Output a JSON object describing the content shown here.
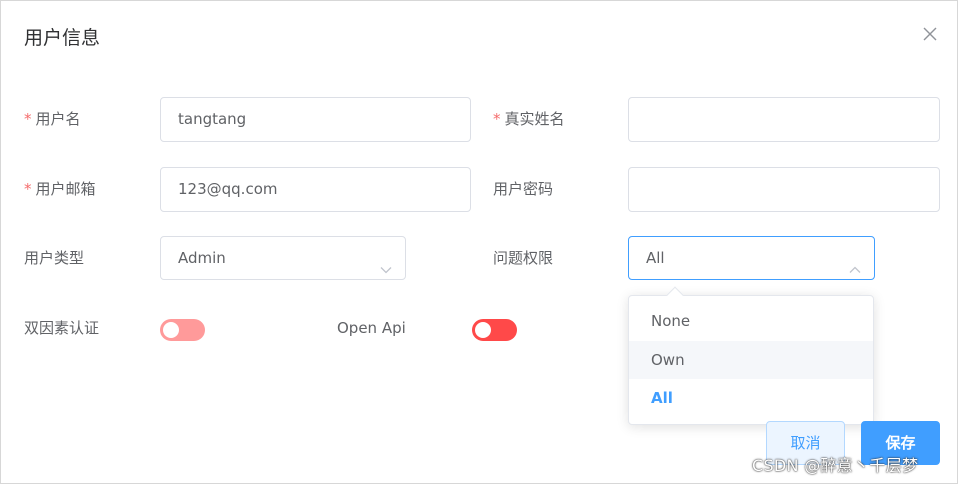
{
  "dialog": {
    "title": "用户信息",
    "close_icon": "close-icon"
  },
  "form": {
    "username": {
      "required": "*",
      "label": "用户名",
      "value": "tangtang"
    },
    "realname": {
      "required": "*",
      "label": "真实姓名",
      "value": ""
    },
    "email": {
      "required": "*",
      "label": "用户邮箱",
      "value": "123@qq.com"
    },
    "password": {
      "label": "用户密码",
      "value": ""
    },
    "user_type": {
      "label": "用户类型",
      "value": "Admin"
    },
    "permission": {
      "label": "问题权限",
      "value": "All",
      "options": [
        "None",
        "Own",
        "All"
      ],
      "hovered": "Own",
      "selected": "All"
    },
    "two_factor": {
      "label": "双因素认证",
      "on": false,
      "color": "#ff9a9a"
    },
    "open_api": {
      "label": "Open Api",
      "on": false,
      "color": "#ff4949"
    }
  },
  "buttons": {
    "cancel": "取消",
    "save": "保存"
  },
  "watermark": "CSDN @醉意丶千层梦",
  "colors": {
    "accent": "#409eff",
    "required": "#f56c6c"
  }
}
